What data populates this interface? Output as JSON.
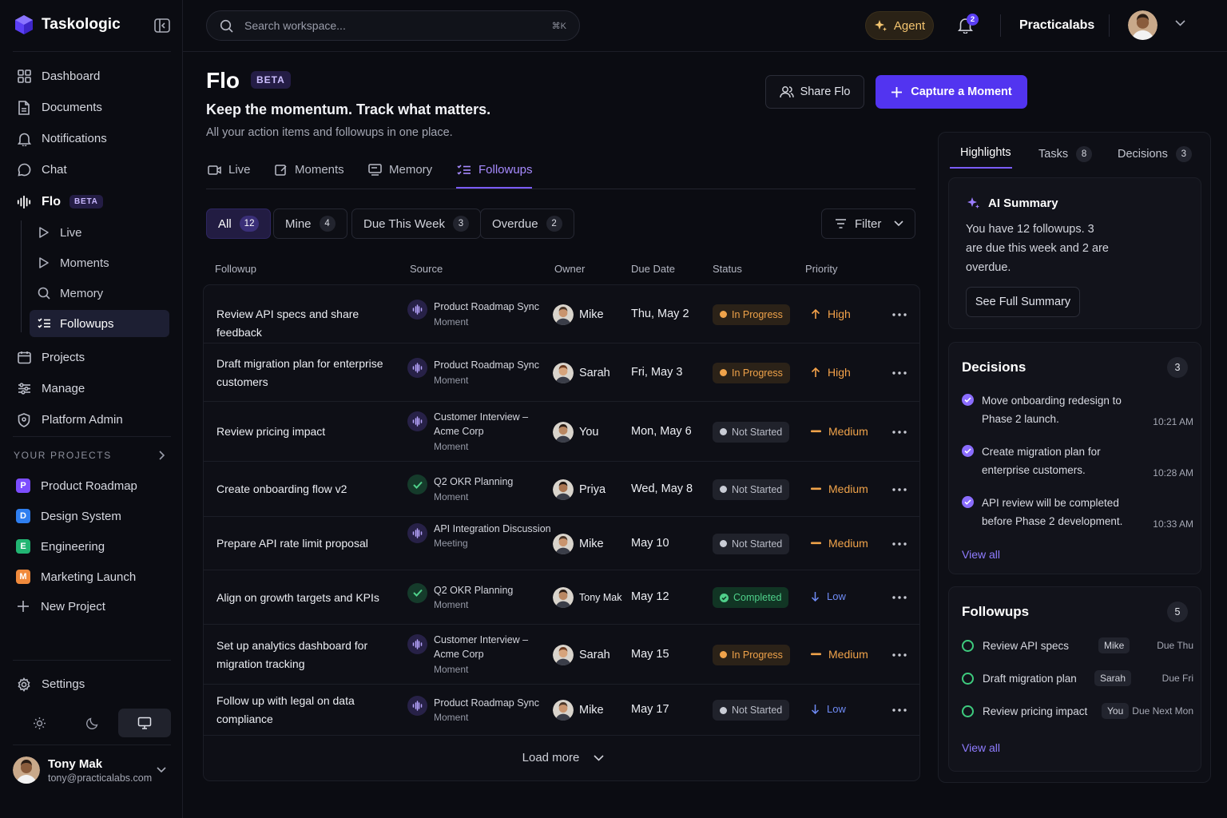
{
  "app": {
    "name": "Taskologic"
  },
  "sidebar": {
    "nav": [
      {
        "label": "Dashboard",
        "icon": "grid-icon"
      },
      {
        "label": "Documents",
        "icon": "document-icon"
      },
      {
        "label": "Notifications",
        "icon": "bell-icon"
      },
      {
        "label": "Chat",
        "icon": "chat-icon"
      }
    ],
    "flo": {
      "label": "Flo",
      "badge": "BETA"
    },
    "flo_sub": [
      {
        "label": "Live",
        "icon": "play-icon"
      },
      {
        "label": "Moments",
        "icon": "play-icon"
      },
      {
        "label": "Memory",
        "icon": "search-icon"
      },
      {
        "label": "Followups",
        "icon": "checklist-icon"
      }
    ],
    "nav2": [
      {
        "label": "Projects",
        "icon": "calendar-icon"
      },
      {
        "label": "Manage",
        "icon": "sliders-icon"
      },
      {
        "label": "Platform Admin",
        "icon": "shield-icon"
      }
    ],
    "projects_label": "YOUR PROJECTS",
    "projects": [
      {
        "letter": "P",
        "label": "Product Roadmap",
        "color": "#7c4dff"
      },
      {
        "letter": "D",
        "label": "Design System",
        "color": "#2f7ff0"
      },
      {
        "letter": "E",
        "label": "Engineering",
        "color": "#22b573"
      },
      {
        "letter": "M",
        "label": "Marketing Launch",
        "color": "#f08a3c"
      }
    ],
    "new_project": "New Project",
    "settings": "Settings",
    "user": {
      "name": "Tony Mak",
      "email": "tony@practicalabs.com"
    }
  },
  "topbar": {
    "search_placeholder": "Search workspace...",
    "shortcut": "⌘K",
    "agent": "Agent",
    "notif_count": "2",
    "org": "Practicalabs"
  },
  "page": {
    "title": "Flo",
    "badge": "BETA",
    "subtitle": "Keep the momentum. Track what matters.",
    "description": "All your action items and followups in one place.",
    "share": "Share Flo",
    "capture": "Capture a Moment"
  },
  "tabs": [
    {
      "label": "Live"
    },
    {
      "label": "Moments"
    },
    {
      "label": "Memory"
    },
    {
      "label": "Followups"
    }
  ],
  "filters": [
    {
      "label": "All",
      "count": "12"
    },
    {
      "label": "Mine",
      "count": "4"
    },
    {
      "label": "Due This Week",
      "count": "3"
    },
    {
      "label": "Overdue",
      "count": "2"
    }
  ],
  "filter_button": "Filter",
  "table": {
    "headers": [
      "Followup",
      "Source",
      "Owner",
      "Due Date",
      "Status",
      "Priority"
    ],
    "rows": [
      {
        "task": "Review API specs and share feedback",
        "source": "Product Roadmap Sync",
        "source_type": "Moment",
        "owner": "Mike",
        "due": "Thu, May 2",
        "status": "In Progress",
        "priority": "High"
      },
      {
        "task": "Draft migration plan for enterprise customers",
        "source": "Product Roadmap Sync",
        "source_type": "Moment",
        "owner": "Sarah",
        "due": "Fri, May 3",
        "status": "In Progress",
        "priority": "High"
      },
      {
        "task": "Review pricing impact",
        "source": "Customer Interview – Acme Corp",
        "source_type": "Moment",
        "owner": "You",
        "due": "Mon, May 6",
        "status": "Not Started",
        "priority": "Medium"
      },
      {
        "task": "Create onboarding flow v2",
        "source": "Q2 OKR Planning",
        "source_type": "Moment",
        "owner": "Priya",
        "due": "Wed, May 8",
        "status": "Not Started",
        "priority": "Medium"
      },
      {
        "task": "Prepare API rate limit proposal",
        "source": "API Integration Discussion",
        "source_type": "Meeting",
        "owner": "Mike",
        "due": "May 10",
        "status": "Not Started",
        "priority": "Medium"
      },
      {
        "task": "Align on growth targets and KPIs",
        "source": "Q2 OKR Planning",
        "source_type": "Moment",
        "owner": "Tony Mak",
        "due": "May 12",
        "status": "Completed",
        "priority": "Low"
      },
      {
        "task": "Set up analytics dashboard for migration tracking",
        "source": "Customer Interview – Acme Corp",
        "source_type": "Moment",
        "owner": "Sarah",
        "due": "May 15",
        "status": "In Progress",
        "priority": "Medium"
      },
      {
        "task": "Follow up with legal on data compliance",
        "source": "Product Roadmap Sync",
        "source_type": "Moment",
        "owner": "Mike",
        "due": "May 17",
        "status": "Not Started",
        "priority": "Low"
      }
    ],
    "load_more": "Load more"
  },
  "panel": {
    "tabs": [
      {
        "label": "Highlights"
      },
      {
        "label": "Tasks",
        "count": "8"
      },
      {
        "label": "Decisions",
        "count": "3"
      }
    ],
    "ai_summary": {
      "title": "AI Summary",
      "text": "You have 12 followups. 3 are due this week and 2 are overdue.",
      "button": "See Full Summary"
    },
    "decisions": {
      "title": "Decisions",
      "count": "3",
      "items": [
        {
          "text": "Move onboarding redesign to Phase 2 launch.",
          "time": "10:21 AM"
        },
        {
          "text": "Create migration plan for enterprise customers.",
          "time": "10:28 AM"
        },
        {
          "text": "API review will be completed before Phase 2 development.",
          "time": "10:33 AM"
        }
      ],
      "view_all": "View all"
    },
    "followups": {
      "title": "Followups",
      "count": "5",
      "items": [
        {
          "text": "Review API specs",
          "owner": "Mike",
          "due": "Due Thu"
        },
        {
          "text": "Draft migration plan",
          "owner": "Sarah",
          "due": "Due Fri"
        },
        {
          "text": "Review pricing impact",
          "owner": "You",
          "due": "Due Next Mon"
        }
      ],
      "view_all": "View all"
    }
  },
  "colors": {
    "accent": "#5234f0",
    "accent_light": "#8f7cff",
    "in_progress": "#f0a34a",
    "completed": "#4fd08a",
    "low": "#6f8bf5"
  }
}
